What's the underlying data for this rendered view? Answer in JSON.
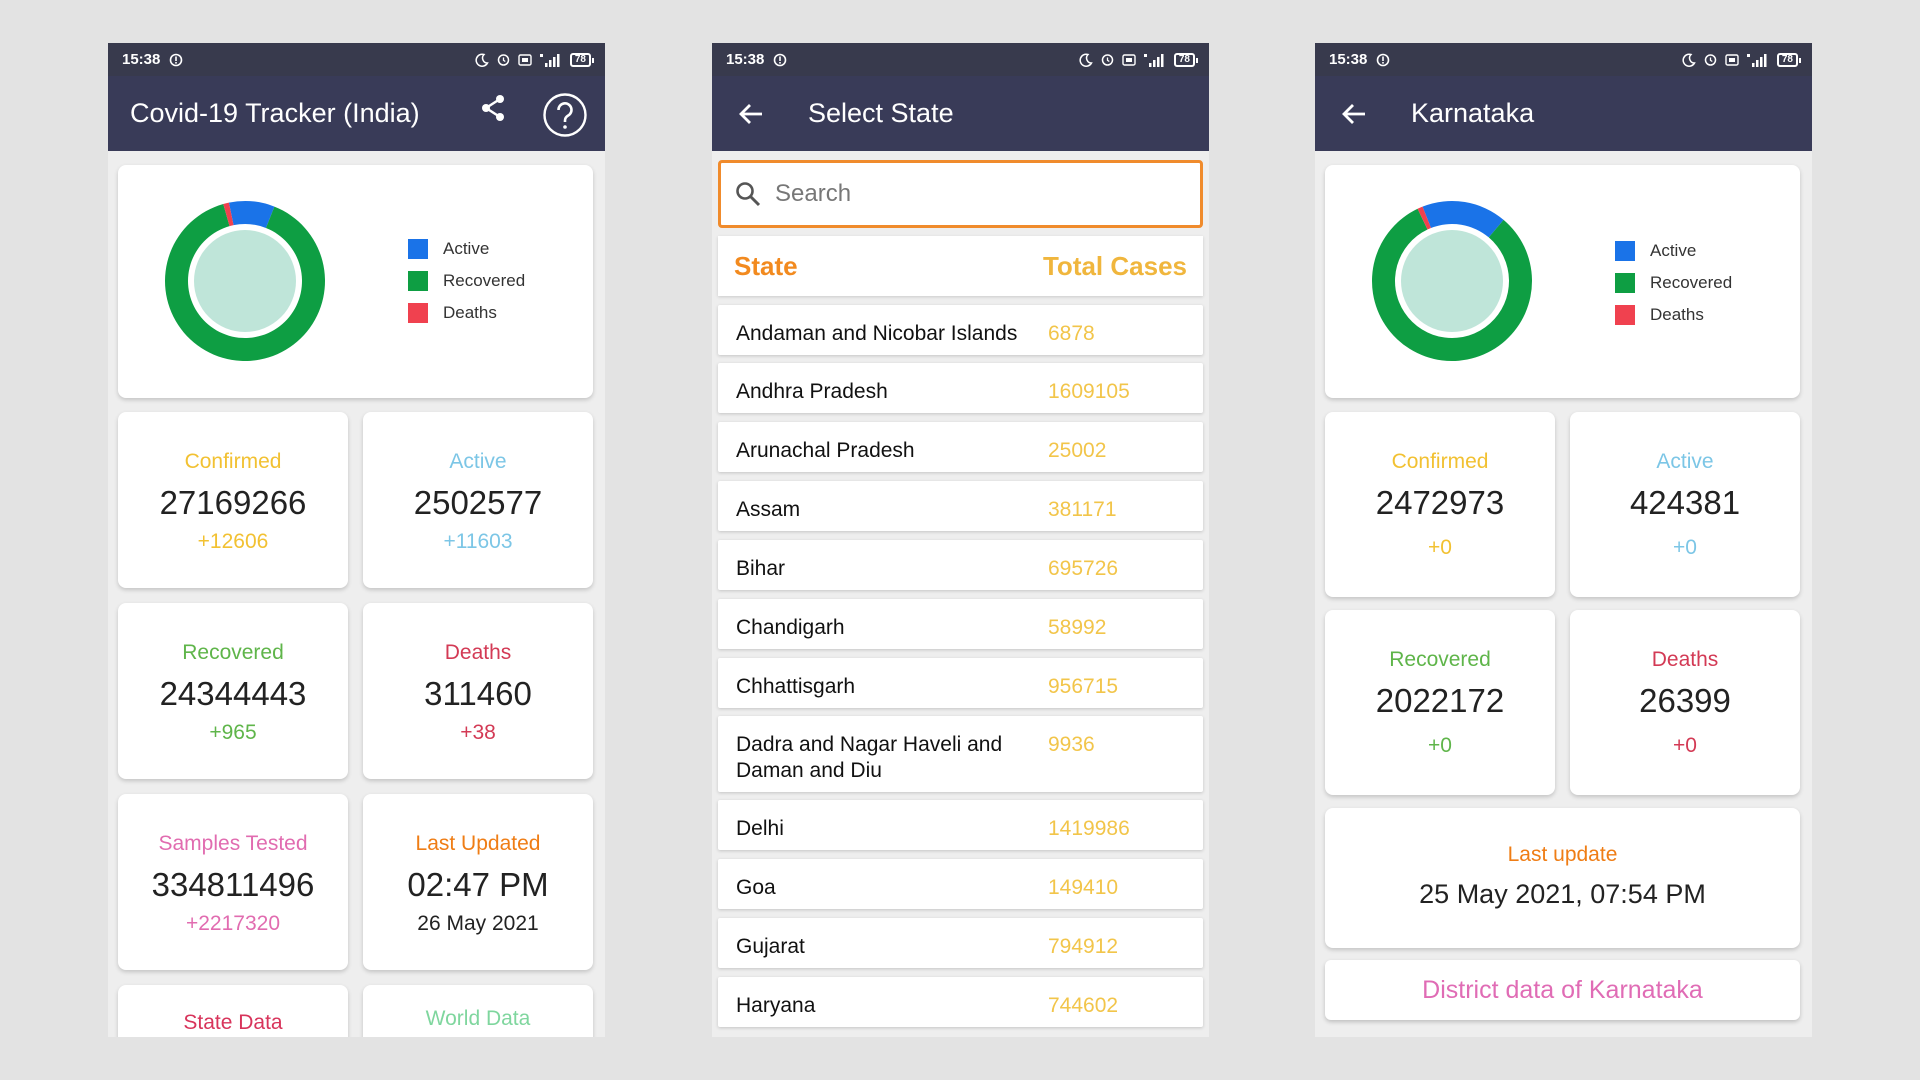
{
  "colors": {
    "active": "#1a73e8",
    "recovered": "#0e9e43",
    "deaths": "#f0414f",
    "donut_center": "#bfe5d9",
    "confirmed": "#f2c132",
    "active_text": "#7cc6e6",
    "recovered_text": "#5fb54a",
    "deaths_text": "#d33a55",
    "samples_text": "#e16cb0",
    "last_updated_text": "#ef7d15",
    "state_data_text": "#d8345b",
    "world_data_text": "#7fd69e",
    "appbar_bg": "#393b58"
  },
  "status_bar": {
    "time": "15:38",
    "battery": "78"
  },
  "screen_main": {
    "title": "Covid-19 Tracker (India)",
    "icons": {
      "share": "share-icon",
      "help": "help-icon"
    },
    "legend": [
      "Active",
      "Recovered",
      "Deaths"
    ],
    "donut": {
      "active": 2502577,
      "recovered": 24344443,
      "deaths": 311460
    },
    "confirmed": {
      "label": "Confirmed",
      "value": "27169266",
      "delta": "+12606"
    },
    "active": {
      "label": "Active",
      "value": "2502577",
      "delta": "+11603"
    },
    "recovered": {
      "label": "Recovered",
      "value": "24344443",
      "delta": "+965"
    },
    "deaths": {
      "label": "Deaths",
      "value": "311460",
      "delta": "+38"
    },
    "samples": {
      "label": "Samples Tested",
      "value": "334811496",
      "delta": "+2217320"
    },
    "last_updated": {
      "label": "Last Updated",
      "time": "02:47 PM",
      "date": "26 May 2021"
    },
    "state_data_label": "State Data",
    "world_data_label": "World Data"
  },
  "screen_states": {
    "title": "Select State",
    "search_placeholder": "Search",
    "header_state": "State",
    "header_total": "Total Cases",
    "rows": [
      {
        "name": "Andaman and Nicobar Islands",
        "cases": "6878"
      },
      {
        "name": "Andhra Pradesh",
        "cases": "1609105"
      },
      {
        "name": "Arunachal Pradesh",
        "cases": "25002"
      },
      {
        "name": "Assam",
        "cases": "381171"
      },
      {
        "name": "Bihar",
        "cases": "695726"
      },
      {
        "name": "Chandigarh",
        "cases": "58992"
      },
      {
        "name": "Chhattisgarh",
        "cases": "956715"
      },
      {
        "name": "Dadra and Nagar Haveli and Daman and Diu",
        "cases": "9936"
      },
      {
        "name": "Delhi",
        "cases": "1419986"
      },
      {
        "name": "Goa",
        "cases": "149410"
      },
      {
        "name": "Gujarat",
        "cases": "794912"
      },
      {
        "name": "Haryana",
        "cases": "744602"
      }
    ]
  },
  "screen_detail": {
    "title": "Karnataka",
    "legend": [
      "Active",
      "Recovered",
      "Deaths"
    ],
    "donut": {
      "active": 424381,
      "recovered": 2022172,
      "deaths": 26399
    },
    "confirmed": {
      "label": "Confirmed",
      "value": "2472973",
      "delta": "+0"
    },
    "active": {
      "label": "Active",
      "value": "424381",
      "delta": "+0"
    },
    "recovered": {
      "label": "Recovered",
      "value": "2022172",
      "delta": "+0"
    },
    "deaths": {
      "label": "Deaths",
      "value": "26399",
      "delta": "+0"
    },
    "last_update": {
      "label": "Last update",
      "value": "25 May 2021, 07:54 PM"
    },
    "district_button": "District data of Karnataka"
  }
}
